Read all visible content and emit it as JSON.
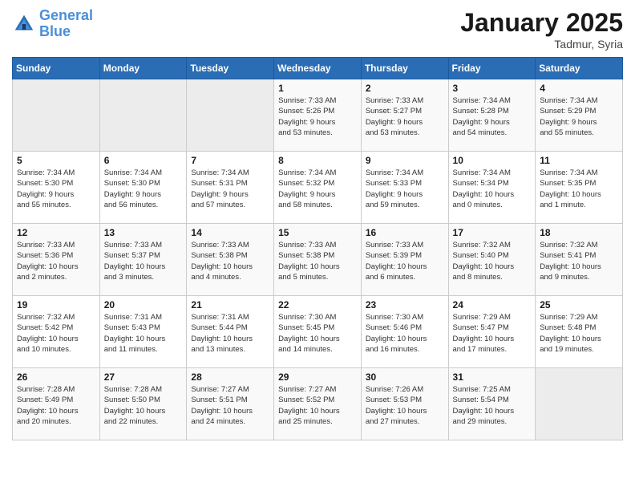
{
  "header": {
    "logo_line1": "General",
    "logo_line2": "Blue",
    "month": "January 2025",
    "location": "Tadmur, Syria"
  },
  "weekdays": [
    "Sunday",
    "Monday",
    "Tuesday",
    "Wednesday",
    "Thursday",
    "Friday",
    "Saturday"
  ],
  "weeks": [
    [
      {
        "day": "",
        "info": ""
      },
      {
        "day": "",
        "info": ""
      },
      {
        "day": "",
        "info": ""
      },
      {
        "day": "1",
        "info": "Sunrise: 7:33 AM\nSunset: 5:26 PM\nDaylight: 9 hours\nand 53 minutes."
      },
      {
        "day": "2",
        "info": "Sunrise: 7:33 AM\nSunset: 5:27 PM\nDaylight: 9 hours\nand 53 minutes."
      },
      {
        "day": "3",
        "info": "Sunrise: 7:34 AM\nSunset: 5:28 PM\nDaylight: 9 hours\nand 54 minutes."
      },
      {
        "day": "4",
        "info": "Sunrise: 7:34 AM\nSunset: 5:29 PM\nDaylight: 9 hours\nand 55 minutes."
      }
    ],
    [
      {
        "day": "5",
        "info": "Sunrise: 7:34 AM\nSunset: 5:30 PM\nDaylight: 9 hours\nand 55 minutes."
      },
      {
        "day": "6",
        "info": "Sunrise: 7:34 AM\nSunset: 5:30 PM\nDaylight: 9 hours\nand 56 minutes."
      },
      {
        "day": "7",
        "info": "Sunrise: 7:34 AM\nSunset: 5:31 PM\nDaylight: 9 hours\nand 57 minutes."
      },
      {
        "day": "8",
        "info": "Sunrise: 7:34 AM\nSunset: 5:32 PM\nDaylight: 9 hours\nand 58 minutes."
      },
      {
        "day": "9",
        "info": "Sunrise: 7:34 AM\nSunset: 5:33 PM\nDaylight: 9 hours\nand 59 minutes."
      },
      {
        "day": "10",
        "info": "Sunrise: 7:34 AM\nSunset: 5:34 PM\nDaylight: 10 hours\nand 0 minutes."
      },
      {
        "day": "11",
        "info": "Sunrise: 7:34 AM\nSunset: 5:35 PM\nDaylight: 10 hours\nand 1 minute."
      }
    ],
    [
      {
        "day": "12",
        "info": "Sunrise: 7:33 AM\nSunset: 5:36 PM\nDaylight: 10 hours\nand 2 minutes."
      },
      {
        "day": "13",
        "info": "Sunrise: 7:33 AM\nSunset: 5:37 PM\nDaylight: 10 hours\nand 3 minutes."
      },
      {
        "day": "14",
        "info": "Sunrise: 7:33 AM\nSunset: 5:38 PM\nDaylight: 10 hours\nand 4 minutes."
      },
      {
        "day": "15",
        "info": "Sunrise: 7:33 AM\nSunset: 5:38 PM\nDaylight: 10 hours\nand 5 minutes."
      },
      {
        "day": "16",
        "info": "Sunrise: 7:33 AM\nSunset: 5:39 PM\nDaylight: 10 hours\nand 6 minutes."
      },
      {
        "day": "17",
        "info": "Sunrise: 7:32 AM\nSunset: 5:40 PM\nDaylight: 10 hours\nand 8 minutes."
      },
      {
        "day": "18",
        "info": "Sunrise: 7:32 AM\nSunset: 5:41 PM\nDaylight: 10 hours\nand 9 minutes."
      }
    ],
    [
      {
        "day": "19",
        "info": "Sunrise: 7:32 AM\nSunset: 5:42 PM\nDaylight: 10 hours\nand 10 minutes."
      },
      {
        "day": "20",
        "info": "Sunrise: 7:31 AM\nSunset: 5:43 PM\nDaylight: 10 hours\nand 11 minutes."
      },
      {
        "day": "21",
        "info": "Sunrise: 7:31 AM\nSunset: 5:44 PM\nDaylight: 10 hours\nand 13 minutes."
      },
      {
        "day": "22",
        "info": "Sunrise: 7:30 AM\nSunset: 5:45 PM\nDaylight: 10 hours\nand 14 minutes."
      },
      {
        "day": "23",
        "info": "Sunrise: 7:30 AM\nSunset: 5:46 PM\nDaylight: 10 hours\nand 16 minutes."
      },
      {
        "day": "24",
        "info": "Sunrise: 7:29 AM\nSunset: 5:47 PM\nDaylight: 10 hours\nand 17 minutes."
      },
      {
        "day": "25",
        "info": "Sunrise: 7:29 AM\nSunset: 5:48 PM\nDaylight: 10 hours\nand 19 minutes."
      }
    ],
    [
      {
        "day": "26",
        "info": "Sunrise: 7:28 AM\nSunset: 5:49 PM\nDaylight: 10 hours\nand 20 minutes."
      },
      {
        "day": "27",
        "info": "Sunrise: 7:28 AM\nSunset: 5:50 PM\nDaylight: 10 hours\nand 22 minutes."
      },
      {
        "day": "28",
        "info": "Sunrise: 7:27 AM\nSunset: 5:51 PM\nDaylight: 10 hours\nand 24 minutes."
      },
      {
        "day": "29",
        "info": "Sunrise: 7:27 AM\nSunset: 5:52 PM\nDaylight: 10 hours\nand 25 minutes."
      },
      {
        "day": "30",
        "info": "Sunrise: 7:26 AM\nSunset: 5:53 PM\nDaylight: 10 hours\nand 27 minutes."
      },
      {
        "day": "31",
        "info": "Sunrise: 7:25 AM\nSunset: 5:54 PM\nDaylight: 10 hours\nand 29 minutes."
      },
      {
        "day": "",
        "info": ""
      }
    ]
  ]
}
